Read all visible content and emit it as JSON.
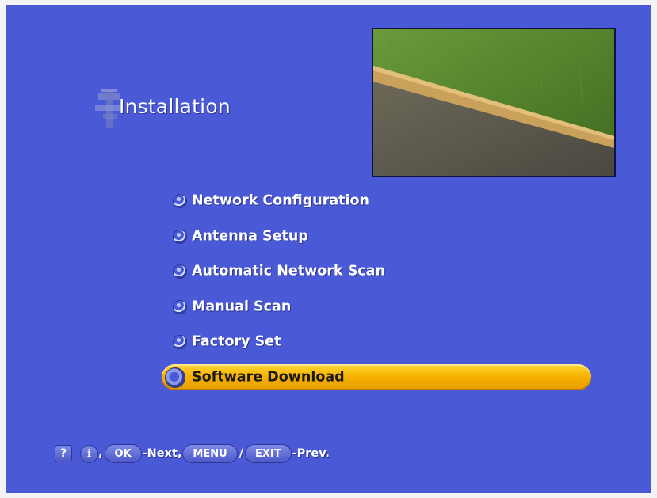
{
  "page": {
    "title": "Installation"
  },
  "menu": {
    "items": [
      {
        "label": "Network Configuration"
      },
      {
        "label": "Antenna Setup"
      },
      {
        "label": "Automatic Network Scan"
      },
      {
        "label": "Manual Scan"
      },
      {
        "label": "Factory Set"
      },
      {
        "label": "Software Download"
      }
    ],
    "selected_index": 5
  },
  "footer": {
    "help_key": "?",
    "info_key": "i",
    "comma": ",",
    "ok_key": "OK",
    "next_hint": "-Next,",
    "menu_key": "MENU",
    "slash": "/",
    "exit_key": "EXIT",
    "prev_hint": "-Prev."
  },
  "colors": {
    "background": "#4a5ad6",
    "highlight": "#f8b300",
    "text": "#ffffff"
  },
  "icons": {
    "title_icon": "installation-icon",
    "bullet": "menu-bullet-icon"
  }
}
